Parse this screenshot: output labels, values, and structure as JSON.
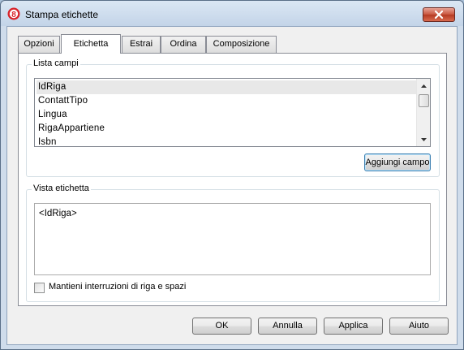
{
  "window": {
    "title": "Stampa etichette"
  },
  "tabs": [
    {
      "label": "Opzioni",
      "active": false
    },
    {
      "label": "Etichetta",
      "active": true
    },
    {
      "label": "Estrai",
      "active": false
    },
    {
      "label": "Ordina",
      "active": false
    },
    {
      "label": "Composizione",
      "active": false
    }
  ],
  "fields_group": {
    "label": "Lista campi",
    "items": [
      "IdRiga",
      "ContattTipo",
      "Lingua",
      "RigaAppartiene",
      "Isbn"
    ],
    "selected_index": 0,
    "add_button": "Aggiungi campo"
  },
  "preview_group": {
    "label": "Vista etichetta",
    "text": "<IdRiga>",
    "checkbox_label": "Mantieni interruzioni di riga e spazi",
    "checkbox_checked": false
  },
  "footer": {
    "ok": "OK",
    "cancel": "Annulla",
    "apply": "Applica",
    "help": "Aiuto"
  },
  "colors": {
    "title_bar": "#c3d4e8",
    "close_button": "#c8553d",
    "focus_border": "#3c7fb1"
  },
  "icons": {
    "app": "banana-app-icon",
    "close": "close-icon"
  }
}
